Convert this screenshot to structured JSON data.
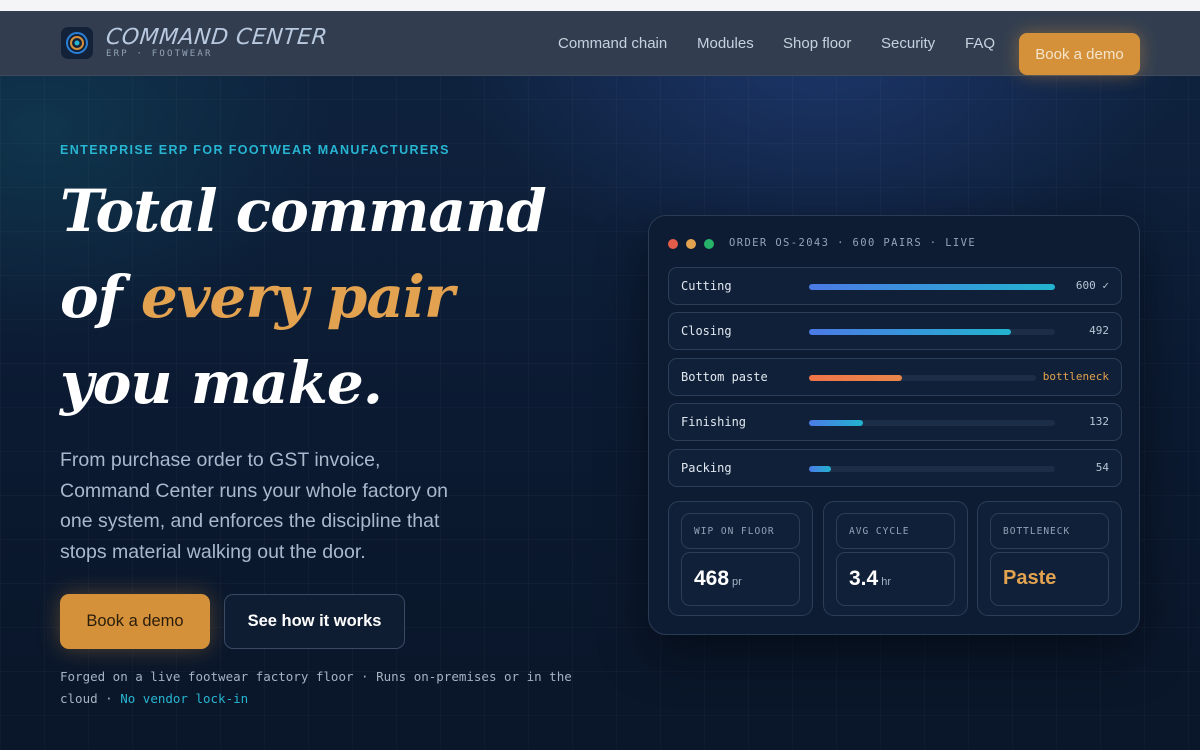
{
  "nav": {
    "brand_name": "COMMAND CENTER",
    "brand_sub": "ERP · FOOTWEAR",
    "links": [
      "Command chain",
      "Modules",
      "Shop floor",
      "Security",
      "FAQ"
    ],
    "cta": "Book a demo"
  },
  "hero": {
    "eyebrow": "ENTERPRISE ERP FOR FOOTWEAR MANUFACTURERS",
    "headline": {
      "line1": "Total command",
      "line2_prefix": "of ",
      "line2_accent": "every pair",
      "line3": "you make."
    },
    "lede": "From purchase order to GST invoice, Command Center runs your whole factory on one system, and enforces the discipline that stops material walking out the door.",
    "primary_button": "Book a demo",
    "secondary_button": "See how it works",
    "footnote": {
      "text": "Forged on a live footwear factory floor · Runs on-premises or in the cloud · ",
      "highlight": "No vendor lock-in"
    }
  },
  "panel": {
    "title": "ORDER OS-2043 · 600 PAIRS · LIVE",
    "window_dots": [
      "#e35d4a",
      "#e2a24f",
      "#27b36a"
    ],
    "stages": [
      {
        "label": "Cutting",
        "progress": 1.0,
        "value": "600 ✓",
        "status": "normal"
      },
      {
        "label": "Closing",
        "progress": 0.82,
        "value": "492",
        "status": "normal"
      },
      {
        "label": "Bottom paste",
        "progress": 0.41,
        "value": "bottleneck",
        "status": "warn"
      },
      {
        "label": "Finishing",
        "progress": 0.22,
        "value": "132",
        "status": "normal"
      },
      {
        "label": "Packing",
        "progress": 0.09,
        "value": "54",
        "status": "normal"
      }
    ],
    "stats": [
      {
        "label": "WIP ON FLOOR",
        "value": "468",
        "unit": "pr",
        "status": "normal"
      },
      {
        "label": "AVG CYCLE",
        "value": "3.4",
        "unit": "hr",
        "status": "normal"
      },
      {
        "label": "BOTTLENECK",
        "value": "Paste",
        "unit": "",
        "status": "warn"
      }
    ]
  },
  "colors": {
    "accent": "#d4913a",
    "teal": "#27b5d1",
    "warn": "#e8864a",
    "background": "#0b1a30"
  }
}
